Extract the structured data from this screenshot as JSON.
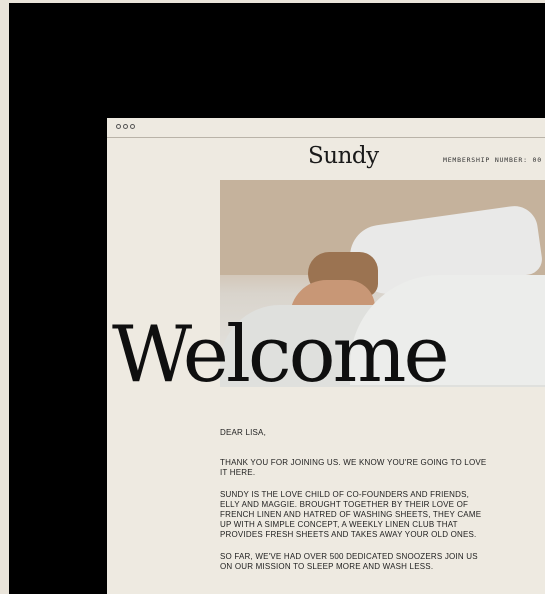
{
  "email": {
    "brand": "Sundy",
    "membership_label": "MEMBERSHIP NUMBER: 00",
    "headline": "Welcome",
    "greeting": "DEAR LISA,",
    "paragraphs": [
      "THANK YOU FOR JOINING US. WE KNOW YOU'RE GOING TO LOVE IT HERE.",
      "SUNDY IS THE LOVE CHILD OF CO-FOUNDERS AND FRIENDS, ELLY AND MAGGIE. BROUGHT TOGETHER BY THEIR LOVE OF FRENCH LINEN AND HATRED OF WASHING SHEETS, THEY CAME UP WITH A SIMPLE CONCEPT, A WEEKLY LINEN CLUB THAT PROVIDES FRESH SHEETS AND TAKES AWAY YOUR OLD ONES.",
      "SO FAR, WE'VE HAD OVER 500 DEDICATED SNOOZERS JOIN US ON OUR MISSION TO SLEEP MORE AND WASH LESS."
    ]
  },
  "colors": {
    "page_bg": "#000000",
    "paper": "#eeeae1",
    "ink": "#0f0f0f"
  }
}
